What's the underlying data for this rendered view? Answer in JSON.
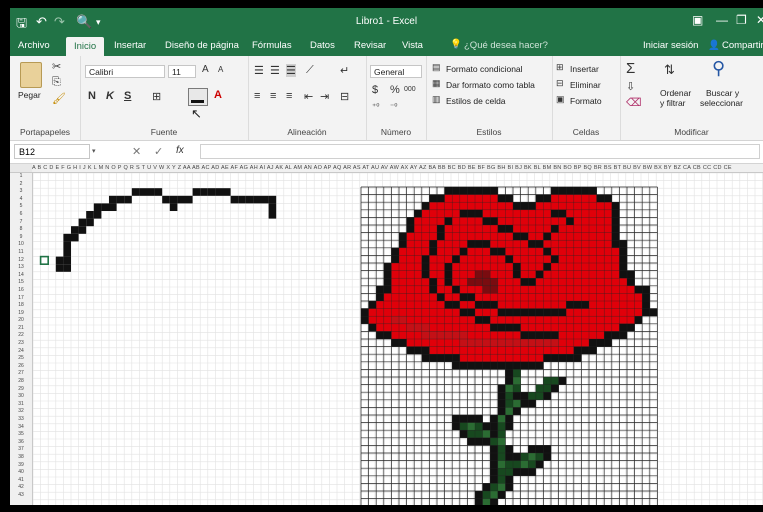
{
  "qat": {
    "save": "🖫",
    "undo": "↶",
    "redo": "↷",
    "preview": "🔍",
    "more": "▾"
  },
  "window_title": "Libro1 - Excel",
  "window_controls": {
    "ribbon_opts": "▣",
    "minimize": "—",
    "restore": "❐",
    "close": "✕"
  },
  "tabs": [
    {
      "label": "Archivo",
      "active": false
    },
    {
      "label": "Inicio",
      "active": true
    },
    {
      "label": "Insertar",
      "active": false
    },
    {
      "label": "Diseño de página",
      "active": false
    },
    {
      "label": "Fórmulas",
      "active": false
    },
    {
      "label": "Datos",
      "active": false
    },
    {
      "label": "Revisar",
      "active": false
    },
    {
      "label": "Vista",
      "active": false
    }
  ],
  "tell_me": "¿Qué desea hacer?",
  "sign_in": "Iniciar sesión",
  "share": "Compartir",
  "ribbon": {
    "clipboard": {
      "paste": "Pegar",
      "label": "Portapapeles"
    },
    "font": {
      "name": "Calibri",
      "size": "11",
      "bold": "N",
      "italic": "K",
      "underline": "S",
      "grow": "A",
      "shrink": "A",
      "color_letter": "A",
      "label": "Fuente"
    },
    "alignment": {
      "label": "Alineación"
    },
    "number": {
      "format": "General",
      "currency": "$",
      "percent": "%",
      "thousands": "000",
      "label": "Número"
    },
    "styles": {
      "conditional": "Formato condicional",
      "as_table": "Dar formato como tabla",
      "cell_styles": "Estilos de celda",
      "label": "Estilos"
    },
    "cells": {
      "insert": "Insertar",
      "delete": "Eliminar",
      "format": "Formato",
      "label": "Celdas"
    },
    "editing": {
      "sum": "Σ",
      "sort_line1": "Ordenar",
      "sort_line2": "y filtrar",
      "find_line1": "Buscar y",
      "find_line2": "seleccionar",
      "label": "Modificar"
    }
  },
  "formula_bar": {
    "name_box": "B12",
    "cancel": "✕",
    "enter": "✓",
    "fx": "fx",
    "value": ""
  },
  "sheet": {
    "column_headers": "A B C D E F G H I J K L M N O P Q R S T U V W X Y Z AA AB AC AD AE AF AG AH AI AJ AK AL AM AN AO AP AQ AR AS AT AU AV AW AX AY AZ BA BB BC BD BE BF BG BH BI BJ BK BL BM BN BO BP BQ BR BS BT BU BV BW BX BY BZ CA CB CC CD CE",
    "row_count": 43,
    "selected_cell": "B12"
  },
  "colors": {
    "excel_green": "#217346",
    "black_fill": "#111111",
    "red_bright": "#e0000a",
    "red_mid": "#c41016",
    "red_dark": "#7a0c10",
    "green_dark": "#17481f",
    "green_light": "#2b6c33"
  },
  "icons": {
    "paste": "clipboard-icon",
    "cut": "scissors-icon",
    "copy": "copy-icon",
    "format_painter": "brush-icon",
    "fill_color": "paint-bucket-icon",
    "conditional": "conditional-format-icon",
    "sort": "sort-az-icon",
    "find": "magnifier-icon"
  }
}
